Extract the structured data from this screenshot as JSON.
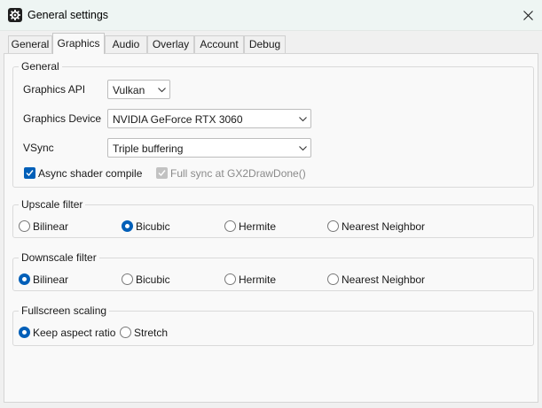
{
  "window": {
    "title": "General settings",
    "icon": "gear-icon",
    "close_icon": "close-icon"
  },
  "tabs": [
    {
      "label": "General",
      "active": false
    },
    {
      "label": "Graphics",
      "active": true
    },
    {
      "label": "Audio",
      "active": false
    },
    {
      "label": "Overlay",
      "active": false
    },
    {
      "label": "Account",
      "active": false
    },
    {
      "label": "Debug",
      "active": false
    }
  ],
  "general_group": {
    "title": "General",
    "graphics_api": {
      "label": "Graphics API",
      "value": "Vulkan"
    },
    "graphics_device": {
      "label": "Graphics Device",
      "value": "NVIDIA GeForce RTX 3060"
    },
    "vsync": {
      "label": "VSync",
      "value": "Triple buffering"
    },
    "async_shader": {
      "label": "Async shader compile",
      "checked": true
    },
    "full_sync": {
      "label": "Full sync at GX2DrawDone()",
      "checked": true,
      "disabled": true
    }
  },
  "upscale_group": {
    "title": "Upscale filter",
    "options": [
      "Bilinear",
      "Bicubic",
      "Hermite",
      "Nearest Neighbor"
    ],
    "selected": "Bicubic"
  },
  "downscale_group": {
    "title": "Downscale filter",
    "options": [
      "Bilinear",
      "Bicubic",
      "Hermite",
      "Nearest Neighbor"
    ],
    "selected": "Bilinear"
  },
  "fullscreen_group": {
    "title": "Fullscreen scaling",
    "options": [
      "Keep aspect ratio",
      "Stretch"
    ],
    "selected": "Keep aspect ratio"
  },
  "colors": {
    "accent": "#005fb8",
    "titlebar": "#eef5f3",
    "panel": "#f9f9f9",
    "window": "#f0f0f0"
  }
}
